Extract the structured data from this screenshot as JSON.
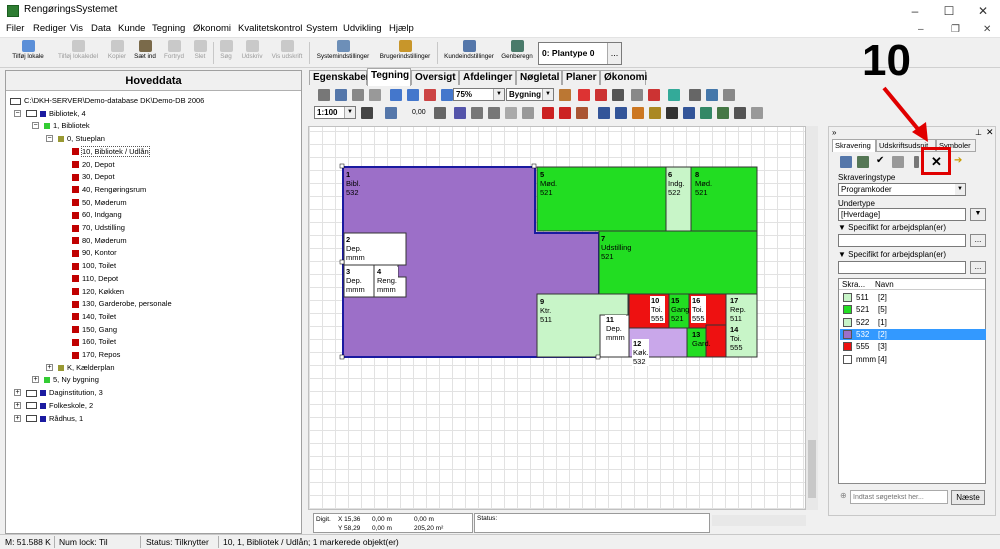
{
  "window": {
    "title": "RengøringsSystemet",
    "minimize": "–",
    "maximize": "☐",
    "close": "✕"
  },
  "menu": [
    "Filer",
    "Rediger",
    "Vis",
    "Data",
    "Kunde",
    "Tegning",
    "Økonomi",
    "Kvalitetskontrol",
    "System",
    "Udvikling",
    "Hjælp"
  ],
  "mdi_controls": {
    "minimize": "–",
    "restore": "❐",
    "close": "✕"
  },
  "toolbar": {
    "buttons": [
      {
        "label": "Tilføj lokale",
        "enabled": true
      },
      {
        "label": "Tilføj lokaledel",
        "enabled": false
      },
      {
        "label": "Kopier",
        "enabled": false
      },
      {
        "label": "Sæt ind",
        "enabled": true
      },
      {
        "label": "Fortryd",
        "enabled": false
      },
      {
        "label": "Slet",
        "enabled": false
      },
      {
        "label": "Søg",
        "enabled": false
      },
      {
        "label": "Udskriv",
        "enabled": false
      },
      {
        "label": "Vis udskrift",
        "enabled": false
      },
      {
        "label": "Systemindstillinger",
        "enabled": true
      },
      {
        "label": "Brugerindstillinger",
        "enabled": true
      },
      {
        "label": "Kundeindstillinger",
        "enabled": true
      },
      {
        "label": "Genberegn",
        "enabled": true
      }
    ],
    "plantype": "0: Plantype 0",
    "plantype_btn": "..."
  },
  "left_panel": {
    "title": "Hoveddata",
    "tree": [
      {
        "label": "C:\\DKH-SERVER\\Demo-database DK\\Demo-DB 2006",
        "level": 0,
        "icon": "database-icon",
        "expand": ""
      },
      {
        "label": "Bibliotek, 4",
        "level": 0,
        "icon": "building-icon",
        "expand": "−",
        "color": "#1a1aa0"
      },
      {
        "label": "1, Bibliotek",
        "level": 1,
        "icon": "floor-icon",
        "expand": "−",
        "color": "#33cc33"
      },
      {
        "label": "0, Stueplan",
        "level": 2,
        "icon": "floor-icon",
        "expand": "−",
        "color": "#999933"
      },
      {
        "label": "10, Bibliotek / Udlån",
        "level": 3,
        "icon": "room-icon",
        "selected": true
      },
      {
        "label": "20, Depot",
        "level": 3,
        "icon": "room-icon"
      },
      {
        "label": "30, Depot",
        "level": 3,
        "icon": "room-icon"
      },
      {
        "label": "40, Rengøringsrum",
        "level": 3,
        "icon": "room-icon"
      },
      {
        "label": "50, Møderum",
        "level": 3,
        "icon": "room-icon"
      },
      {
        "label": "60, Indgang",
        "level": 3,
        "icon": "room-icon"
      },
      {
        "label": "70, Udstilling",
        "level": 3,
        "icon": "room-icon"
      },
      {
        "label": "80, Møderum",
        "level": 3,
        "icon": "room-icon"
      },
      {
        "label": "90, Kontor",
        "level": 3,
        "icon": "room-icon"
      },
      {
        "label": "100, Toilet",
        "level": 3,
        "icon": "room-icon"
      },
      {
        "label": "110, Depot",
        "level": 3,
        "icon": "room-icon"
      },
      {
        "label": "120, Køkken",
        "level": 3,
        "icon": "room-icon"
      },
      {
        "label": "130, Garderobe, personale",
        "level": 3,
        "icon": "room-icon"
      },
      {
        "label": "140, Toilet",
        "level": 3,
        "icon": "room-icon"
      },
      {
        "label": "150, Gang",
        "level": 3,
        "icon": "room-icon"
      },
      {
        "label": "160, Toilet",
        "level": 3,
        "icon": "room-icon"
      },
      {
        "label": "170, Repos",
        "level": 3,
        "icon": "room-icon"
      },
      {
        "label": "K, Kælderplan",
        "level": 2,
        "icon": "floor-icon",
        "expand": "+",
        "color": "#999933"
      },
      {
        "label": "5, Ny bygning",
        "level": 1,
        "icon": "floor-icon",
        "expand": "+",
        "color": "#33cc33"
      },
      {
        "label": "Daginstitution, 3",
        "level": 0,
        "icon": "building-icon",
        "expand": "+",
        "color": "#1a1aa0"
      },
      {
        "label": "Folkeskole, 2",
        "level": 0,
        "icon": "building-icon",
        "expand": "+",
        "color": "#1a1aa0"
      },
      {
        "label": "Rådhus, 1",
        "level": 0,
        "icon": "building-icon",
        "expand": "+",
        "color": "#1a1aa0"
      }
    ]
  },
  "tabs": [
    {
      "label": "Egenskaber",
      "active": false
    },
    {
      "label": "Tegning",
      "active": true
    },
    {
      "label": "Oversigt",
      "active": false
    },
    {
      "label": "Afdelinger",
      "active": false
    },
    {
      "label": "Nøgletal",
      "active": false
    },
    {
      "label": "Planer",
      "active": false
    },
    {
      "label": "Økonomi",
      "active": false
    }
  ],
  "drawing_toolbar": {
    "zoom": "75%",
    "view": "Bygning",
    "scale": "1:100",
    "line_width": "0,00"
  },
  "floorplan": {
    "rooms": [
      {
        "num": "1",
        "name": "Bibl.",
        "code": "532",
        "color": "#9c6fc8"
      },
      {
        "num": "2",
        "name": "Dep.",
        "code": "mmm",
        "color": "#ffffff"
      },
      {
        "num": "3",
        "name": "Dep.",
        "code": "mmm",
        "color": "#ffffff"
      },
      {
        "num": "4",
        "name": "Reng.",
        "code": "mmm",
        "color": "#ffffff"
      },
      {
        "num": "5",
        "name": "Mød.",
        "code": "521",
        "color": "#22dd22"
      },
      {
        "num": "6",
        "name": "Indg.",
        "code": "522",
        "color": "#c8f5c8"
      },
      {
        "num": "7",
        "name": "Udstilling",
        "code": "521",
        "color": "#22dd22"
      },
      {
        "num": "8",
        "name": "Mød.",
        "code": "521",
        "color": "#22dd22"
      },
      {
        "num": "9",
        "name": "Ktr.",
        "code": "511",
        "color": "#c8f5c8"
      },
      {
        "num": "10",
        "name": "Toi.",
        "code": "555",
        "color": "#ee1111"
      },
      {
        "num": "11",
        "name": "Dep.",
        "code": "mmm",
        "color": "#ffffff"
      },
      {
        "num": "12",
        "name": "Køk.",
        "code": "532",
        "color": "#c9a7ea"
      },
      {
        "num": "13",
        "name": "Gard.",
        "code": "521",
        "color": "#22dd22"
      },
      {
        "num": "14",
        "name": "Toi.",
        "code": "555",
        "color": "#ee1111"
      },
      {
        "num": "15",
        "name": "Gang",
        "code": "521",
        "color": "#22dd22"
      },
      {
        "num": "16",
        "name": "Toi.",
        "code": "555",
        "color": "#ee1111"
      },
      {
        "num": "17",
        "name": "Rep.",
        "code": "511",
        "color": "#c8f5c8"
      }
    ]
  },
  "coord_box": {
    "digit": "Digit.",
    "x": "15,36",
    "y": "58,29",
    "dx": "0,00 m",
    "dy": "0,00 m",
    "da": "0,00 m",
    "area": "205,20 m²",
    "status_label": "Status:"
  },
  "right_panel": {
    "tabs": [
      {
        "label": "Skravering",
        "active": true
      },
      {
        "label": "Udskriftsudsnit",
        "active": false
      },
      {
        "label": "Symboler",
        "active": false
      }
    ],
    "skraveringstype_label": "Skraveringstype",
    "skraveringstype_value": "Programkoder",
    "undertype_label": "Undertype",
    "undertype_value": "[Hverdage]",
    "specifikt1": "Specifikt for arbejdsplan(er)",
    "specifikt2": "Specifikt for arbejdsplan(er)",
    "dots": "...",
    "legend_headers": [
      "Skra...",
      "Navn"
    ],
    "legend": [
      {
        "code": "511",
        "count": "[2]",
        "color": "#c8f5c8",
        "selected": false
      },
      {
        "code": "521",
        "count": "[5]",
        "color": "#22dd22",
        "selected": false
      },
      {
        "code": "522",
        "count": "[1]",
        "color": "#c8f5c8",
        "selected": false
      },
      {
        "code": "532",
        "count": "[2]",
        "color": "#9c6fc8",
        "selected": true
      },
      {
        "code": "555",
        "count": "[3]",
        "color": "#ee1111",
        "selected": false
      },
      {
        "code": "mmm",
        "count": "[4]",
        "color": "#ffffff",
        "selected": false
      }
    ],
    "search_placeholder": "Indtast søgetekst her...",
    "next_button": "Næste"
  },
  "annotation": {
    "number": "10"
  },
  "statusbar": {
    "memory": "M: 51.588 K",
    "numlock": "Num lock: Til",
    "status": "Status: Tilknytter",
    "selection": "10, 1, Bibliotek / Udlån; 1 markerede objekt(er)"
  },
  "colors": {
    "selection": "#3399ff",
    "accent_red": "#e00000",
    "purple": "#9c6fc8",
    "green": "#22dd22",
    "light_green": "#c8f5c8",
    "red": "#ee1111"
  }
}
